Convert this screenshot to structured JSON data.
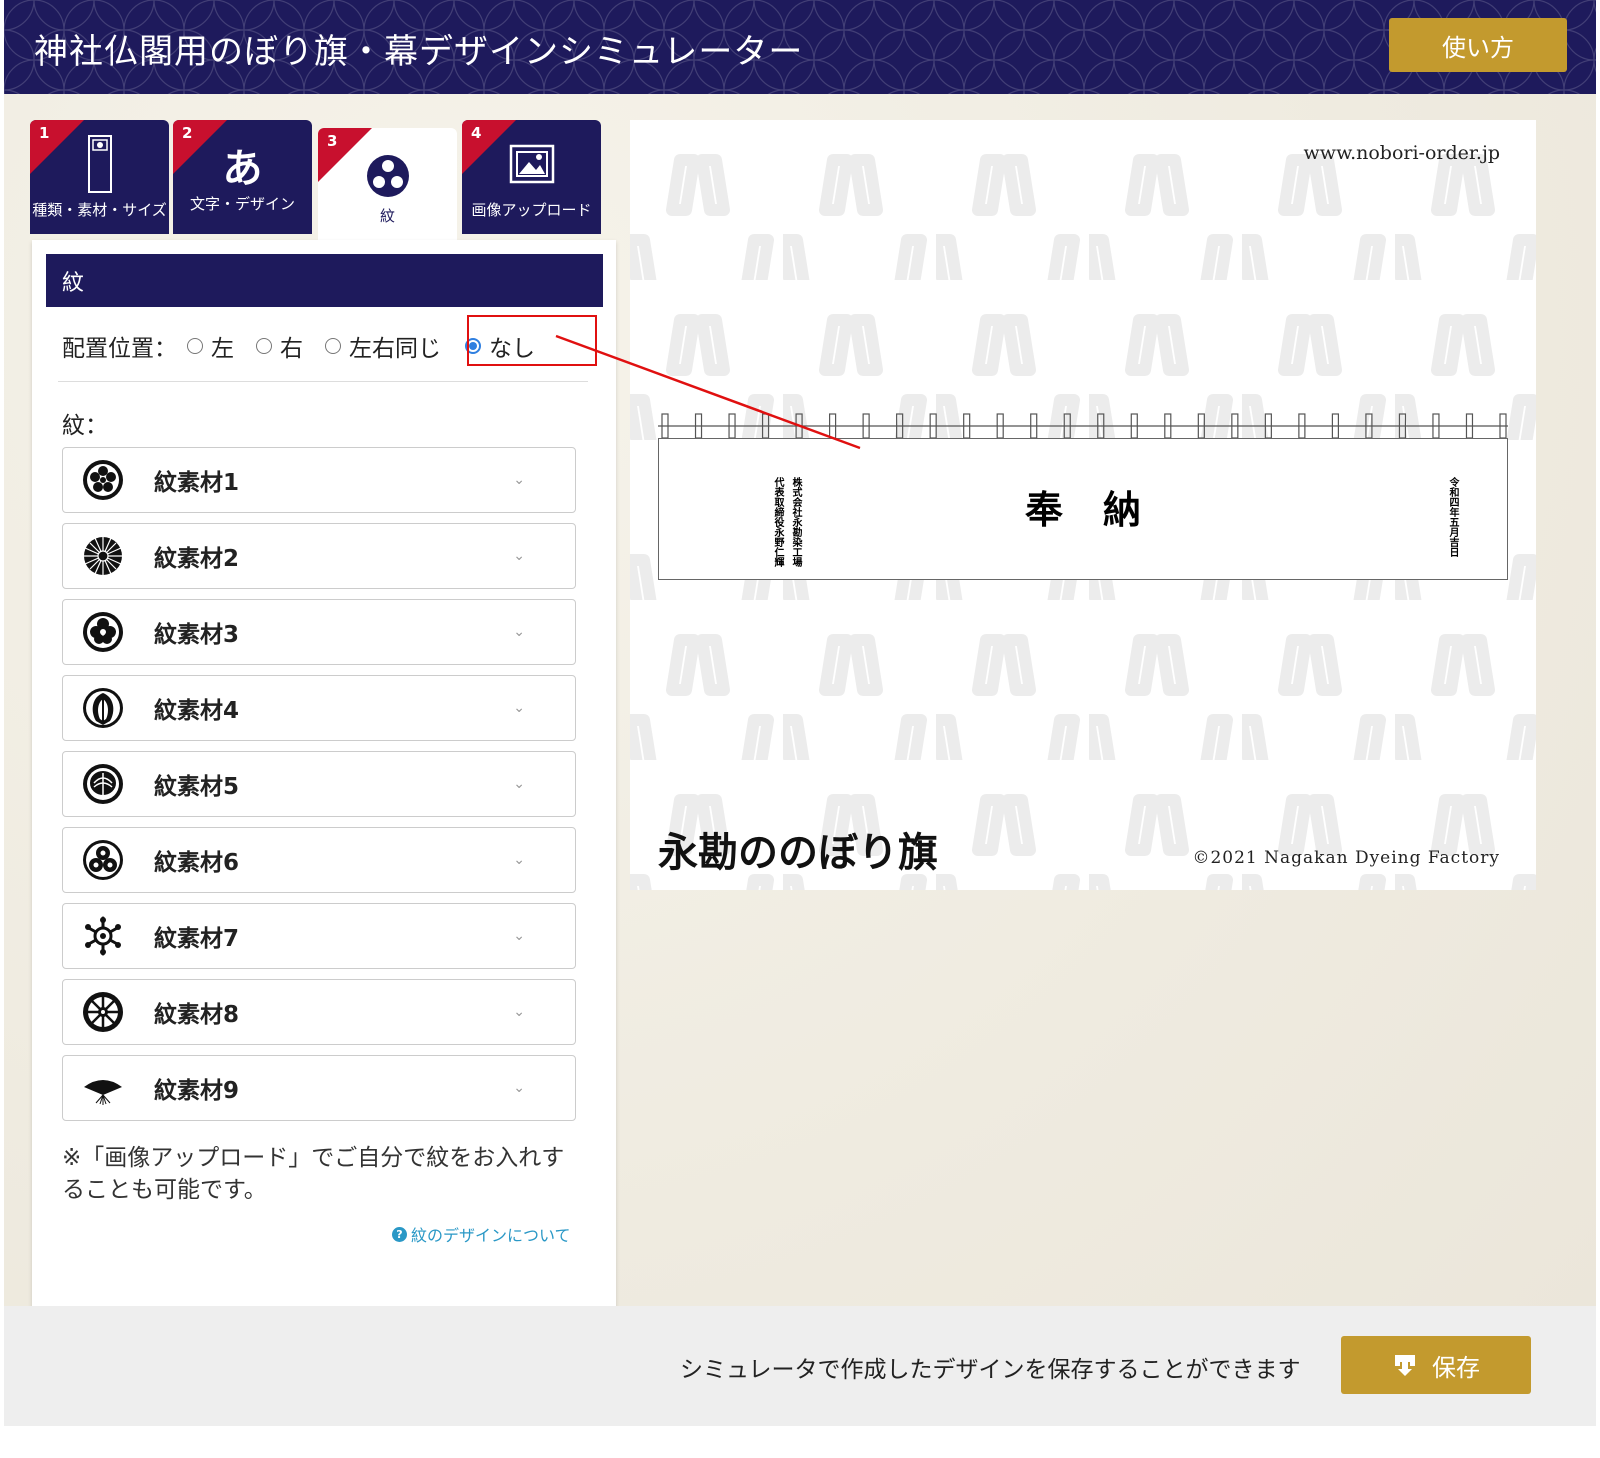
{
  "header": {
    "title": "神社仏閣用のぼり旗・幕デザインシミュレーター",
    "help_label": "使い方"
  },
  "tabs": [
    {
      "num": "1",
      "label": "種類・素材・サイズ",
      "icon": "banner-icon"
    },
    {
      "num": "2",
      "label": "文字・デザイン",
      "icon_text": "あ"
    },
    {
      "num": "3",
      "label": "紋",
      "icon": "tomoe-icon",
      "active": true
    },
    {
      "num": "4",
      "label": "画像アップロード",
      "icon": "image-icon"
    }
  ],
  "panel": {
    "section_title": "紋",
    "position_label": "配置位置：",
    "position_options": [
      "左",
      "右",
      "左右同じ",
      "なし"
    ],
    "position_selected": "なし",
    "mon_label": "紋：",
    "materials": [
      {
        "label": "紋素材1",
        "icon": "crest-5circles-icon"
      },
      {
        "label": "紋素材2",
        "icon": "chrysanthemum-icon"
      },
      {
        "label": "紋素材3",
        "icon": "plum-crest-icon"
      },
      {
        "label": "紋素材4",
        "icon": "wisteria-crest-icon"
      },
      {
        "label": "紋素材5",
        "icon": "paulownia-crest-icon"
      },
      {
        "label": "紋素材6",
        "icon": "tomoe-crest-icon"
      },
      {
        "label": "紋素材7",
        "icon": "snowflake-crest-icon"
      },
      {
        "label": "紋素材8",
        "icon": "wheel-crest-icon"
      },
      {
        "label": "紋素材9",
        "icon": "fan-crest-icon"
      }
    ],
    "note": "※「画像アップロード」でご自分で紋をお入れすることも可能です。",
    "help_link": "紋のデザインについて"
  },
  "preview": {
    "site": "www.nobori-order.jp",
    "banner_main": "奉納",
    "vertical_left_1": "株式会社永勘染工場",
    "vertical_left_2": "代表取締役永野仁輝",
    "vertical_right": "令和四年五月吉日",
    "brand": "永勘ののぼり旗",
    "copyright": "©2021 Nagakan Dyeing Factory"
  },
  "footer": {
    "text": "シミュレータで作成したデザインを保存することができます",
    "save_label": "保存"
  },
  "colors": {
    "navy": "#1e1a5c",
    "gold": "#c39a2e",
    "red": "#c8102e",
    "highlight": "#e01010"
  }
}
